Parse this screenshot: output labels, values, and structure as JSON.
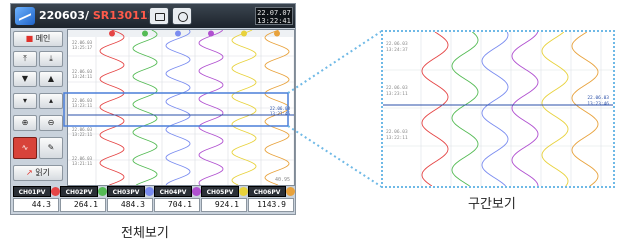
{
  "device": {
    "date": "220603",
    "separator": "/",
    "time": "SR130111",
    "clock_line1": "22.07.07",
    "clock_line2": "13:22:41",
    "side_buttons": {
      "menu_label": "메인",
      "read_label": "읽기"
    }
  },
  "chart": {
    "stamps": [
      {
        "date": "22.06.03",
        "time": "13:25:17"
      },
      {
        "date": "22.06.03",
        "time": "13:24:11"
      },
      {
        "date": "22.06.03",
        "time": "13:23:11"
      },
      {
        "date": "22.06.03",
        "time": "13:22:11"
      },
      {
        "date": "22.06.03",
        "time": "13:21:11"
      }
    ],
    "cursor_stamp": {
      "date": "22.06.03",
      "time": "13:23:46"
    },
    "scale_label": "40.95",
    "colors": [
      "#e54545",
      "#55bb55",
      "#7a8cf0",
      "#b050d0",
      "#e8d23c",
      "#e8a23c"
    ]
  },
  "channels": [
    {
      "name": "CH01PV",
      "value": "44.3",
      "color": "#e54545"
    },
    {
      "name": "CH02PV",
      "value": "264.1",
      "color": "#55bb55"
    },
    {
      "name": "CH03PV",
      "value": "484.3",
      "color": "#7a8cf0"
    },
    {
      "name": "CH04PV",
      "value": "704.1",
      "color": "#b050d0"
    },
    {
      "name": "CH05PV",
      "value": "924.1",
      "color": "#e8d23c"
    },
    {
      "name": "CH06PV",
      "value": "1143.9",
      "color": "#e8a23c"
    }
  ],
  "zoom": {
    "stamps": [
      {
        "date": "22.06.03",
        "time": "13:24:37"
      },
      {
        "date": "22.06.03",
        "time": "13:23:11"
      },
      {
        "date": "22.06.03",
        "time": "13:22:11"
      }
    ],
    "cursor_stamp": {
      "date": "22.06.03",
      "time": "13:23:46"
    }
  },
  "captions": {
    "full_view": "전체보기",
    "section_view": "구간보기"
  }
}
